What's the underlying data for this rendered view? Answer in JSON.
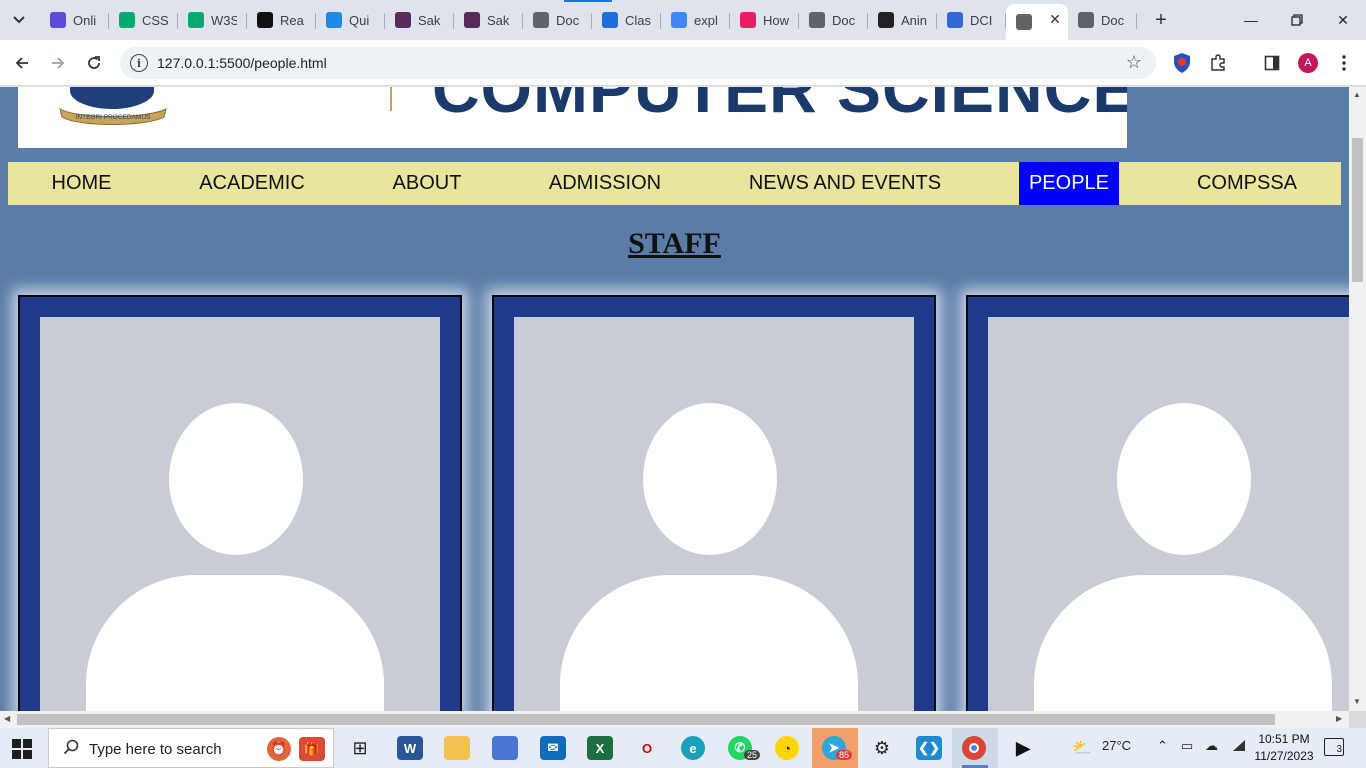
{
  "browser": {
    "tabs": [
      {
        "title": "Onli",
        "icon": "p-icon",
        "color": "#5b4bdb"
      },
      {
        "title": "CSS",
        "icon": "w3-icon",
        "color": "#04aa6d"
      },
      {
        "title": "W3S",
        "icon": "w3-icon",
        "color": "#04aa6d"
      },
      {
        "title": "Rea",
        "icon": "r-icon",
        "color": "#111111"
      },
      {
        "title": "Qui",
        "icon": "react-icon",
        "color": "#1e88e5"
      },
      {
        "title": "Sak",
        "icon": "sakai-icon",
        "color": "#5a2a5e"
      },
      {
        "title": "Sak",
        "icon": "sakai-icon",
        "color": "#5a2a5e"
      },
      {
        "title": "Doc",
        "icon": "globe-icon",
        "color": "#5f6368"
      },
      {
        "title": "Clas",
        "icon": "classroom-icon",
        "color": "#1e6fd9"
      },
      {
        "title": "expl",
        "icon": "google-icon",
        "color": "#4285f4"
      },
      {
        "title": "How",
        "icon": "pin-icon",
        "color": "#e91e63"
      },
      {
        "title": "Doc",
        "icon": "globe-icon",
        "color": "#5f6368"
      },
      {
        "title": "Anin",
        "icon": "github-icon",
        "color": "#222222"
      },
      {
        "title": "DCI",
        "icon": "docs-icon",
        "color": "#3367d6"
      },
      {
        "title": "",
        "icon": "globe-icon",
        "color": "#5f6368",
        "active": true
      },
      {
        "title": "Doc",
        "icon": "globe-icon",
        "color": "#5f6368"
      }
    ],
    "url": "127.0.0.1:5500/people.html",
    "profile_initial": "A"
  },
  "site": {
    "banner_title": "COMPUTER SCIENCE",
    "crest_motto": "INTEGRI PROCEDAMUS",
    "nav": [
      "HOME",
      "ACADEMIC",
      "ABOUT",
      "ADMISSION",
      "NEWS AND EVENTS",
      "PEOPLE",
      "COMPSSA"
    ],
    "active_nav": "PEOPLE",
    "section_title": "STAFF",
    "colors": {
      "page_bg": "#5a7ca5",
      "nav_bg": "#e8e59e",
      "nav_active": "#0000ff",
      "card_frame": "#1f3a8a",
      "banner_title": "#1a3a6b"
    }
  },
  "taskbar": {
    "search_placeholder": "Type here to search",
    "whatsapp_badge": "25",
    "telegram_badge": "85",
    "weather": "27°C",
    "time": "10:51 PM",
    "date": "11/27/2023",
    "notifications": "3"
  }
}
